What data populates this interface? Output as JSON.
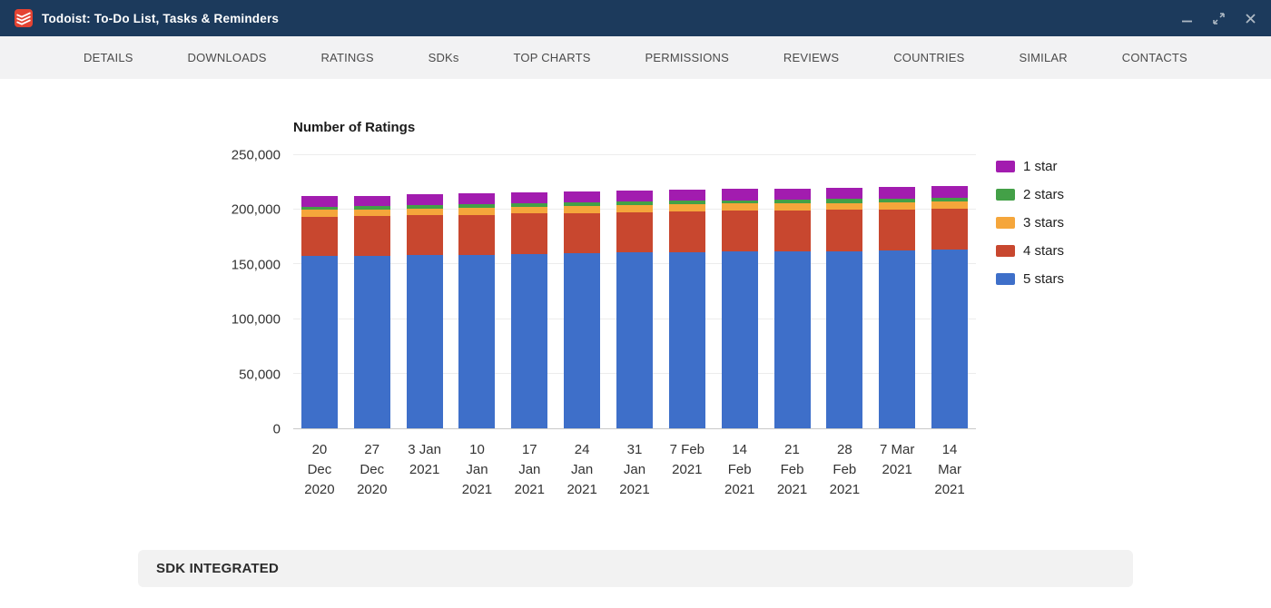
{
  "window": {
    "title": "Todoist: To-Do List, Tasks & Reminders",
    "icons": [
      "todoist-logo-icon",
      "minimize-icon",
      "restore-icon",
      "close-icon"
    ]
  },
  "nav": {
    "tabs": [
      {
        "label": "DETAILS"
      },
      {
        "label": "DOWNLOADS"
      },
      {
        "label": "RATINGS"
      },
      {
        "label": "SDKs"
      },
      {
        "label": "TOP CHARTS"
      },
      {
        "label": "PERMISSIONS"
      },
      {
        "label": "REVIEWS"
      },
      {
        "label": "COUNTRIES"
      },
      {
        "label": "SIMILAR"
      },
      {
        "label": "CONTACTS"
      }
    ]
  },
  "chart_data": {
    "type": "bar",
    "stacked": true,
    "title": "Number of Ratings",
    "categories": [
      "20 Dec 2020",
      "27 Dec 2020",
      "3 Jan 2021",
      "10 Jan 2021",
      "17 Jan 2021",
      "24 Jan 2021",
      "31 Jan 2021",
      "7 Feb 2021",
      "14 Feb 2021",
      "21 Feb 2021",
      "28 Feb 2021",
      "7 Mar 2021",
      "14 Mar 2021"
    ],
    "series": [
      {
        "name": "5 stars",
        "color": "#3E6FC9",
        "values": [
          157500,
          157800,
          158400,
          159000,
          159800,
          160300,
          160800,
          161500,
          161800,
          162000,
          162300,
          162800,
          163400
        ]
      },
      {
        "name": "4 stars",
        "color": "#C8472F",
        "values": [
          36200,
          36300,
          36500,
          36600,
          36800,
          36900,
          37100,
          37200,
          37300,
          37400,
          37500,
          37700,
          37900
        ]
      },
      {
        "name": "3 stars",
        "color": "#F5A63B",
        "values": [
          6100,
          6150,
          6200,
          6250,
          6300,
          6350,
          6400,
          6450,
          6500,
          6550,
          6600,
          6650,
          6700
        ]
      },
      {
        "name": "2 stars",
        "color": "#43A047",
        "values": [
          3100,
          3120,
          3150,
          3170,
          3200,
          3220,
          3250,
          3270,
          3300,
          3320,
          3350,
          3370,
          3400
        ]
      },
      {
        "name": "1 star",
        "color": "#A21CAF",
        "values": [
          9600,
          9650,
          9700,
          9750,
          9800,
          9850,
          9900,
          9950,
          10000,
          10050,
          10100,
          10150,
          10200
        ]
      }
    ],
    "legend_order": [
      "1 star",
      "2 stars",
      "3 stars",
      "4 stars",
      "5 stars"
    ],
    "legend_position": "right",
    "grid": true,
    "ylim": [
      0,
      250000
    ],
    "yticks": [
      0,
      50000,
      100000,
      150000,
      200000,
      250000
    ],
    "ytick_labels": [
      "0",
      "50,000",
      "100,000",
      "150,000",
      "200,000",
      "250,000"
    ]
  },
  "sections": {
    "sdk_integrated": "SDK INTEGRATED"
  }
}
